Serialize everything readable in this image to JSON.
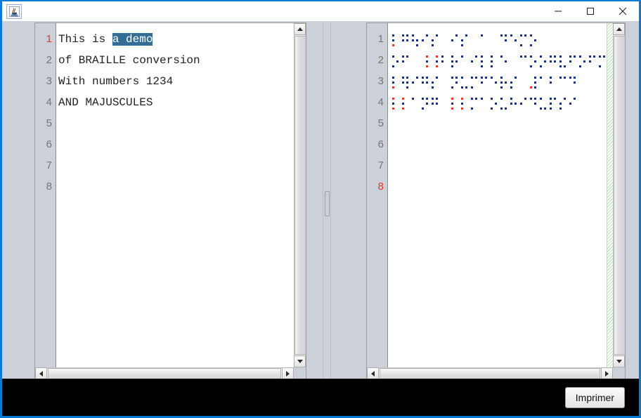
{
  "window": {
    "app_icon": "java-coffee-icon",
    "minimize_label": "—",
    "maximize_label": "□",
    "close_label": "✕"
  },
  "left_editor": {
    "name": "source-text-editor",
    "line_numbers": [
      "1",
      "2",
      "3",
      "4",
      "5",
      "6",
      "7",
      "8"
    ],
    "active_line": 1,
    "lines": [
      {
        "pre": "This is ",
        "selected": "a demo",
        "post": ""
      },
      {
        "pre": "of BRAILLE conversion",
        "selected": "",
        "post": ""
      },
      {
        "pre": "With numbers 1234",
        "selected": "",
        "post": ""
      },
      {
        "pre": "AND MAJUSCULES",
        "selected": "",
        "post": ""
      },
      {
        "pre": "",
        "selected": "",
        "post": ""
      },
      {
        "pre": "",
        "selected": "",
        "post": ""
      },
      {
        "pre": "",
        "selected": "",
        "post": ""
      },
      {
        "pre": "",
        "selected": "",
        "post": ""
      }
    ],
    "selection_text": "a demo"
  },
  "right_editor": {
    "name": "braille-output-editor",
    "line_numbers": [
      "1",
      "2",
      "3",
      "4",
      "5",
      "6",
      "7",
      "8"
    ],
    "active_line": 8,
    "braille_lines": [
      [
        {
          "dots": [
            1,
            2,
            3
          ],
          "red": [
            3
          ]
        },
        {
          "dots": [
            1,
            2,
            4,
            5
          ],
          "red": []
        },
        {
          "dots": [
            1,
            2,
            5,
            6
          ],
          "red": []
        },
        {
          "dots": [
            2,
            4
          ],
          "red": []
        },
        {
          "dots": [
            2,
            3,
            4
          ],
          "red": []
        },
        {
          "dots": [],
          "red": []
        },
        {
          "dots": [
            2,
            4
          ],
          "red": []
        },
        {
          "dots": [
            2,
            3,
            4
          ],
          "red": []
        },
        {
          "dots": [],
          "red": []
        },
        {
          "dots": [
            1
          ],
          "red": []
        },
        {
          "dots": [],
          "red": []
        },
        {
          "dots": [
            1,
            4,
            5
          ],
          "red": []
        },
        {
          "dots": [
            1,
            5
          ],
          "red": []
        },
        {
          "dots": [
            1,
            3,
            4
          ],
          "red": []
        },
        {
          "dots": [
            1,
            3,
            5
          ],
          "red": []
        }
      ],
      [
        {
          "dots": [
            1,
            3,
            5
          ],
          "red": []
        },
        {
          "dots": [
            1,
            2,
            4
          ],
          "red": []
        },
        {
          "dots": [],
          "red": []
        },
        {
          "dots": [
            4,
            5,
            6
          ],
          "red": [
            4,
            6
          ]
        },
        {
          "dots": [
            4,
            5,
            6
          ],
          "red": [
            4,
            6
          ]
        },
        {
          "dots": [
            1,
            2
          ],
          "red": []
        },
        {
          "dots": [
            1,
            2,
            3,
            5
          ],
          "red": []
        },
        {
          "dots": [
            1
          ],
          "red": []
        },
        {
          "dots": [
            2,
            4
          ],
          "red": []
        },
        {
          "dots": [
            1,
            2,
            3
          ],
          "red": []
        },
        {
          "dots": [
            1,
            2,
            3
          ],
          "red": []
        },
        {
          "dots": [
            1,
            5
          ],
          "red": []
        },
        {
          "dots": [],
          "red": []
        },
        {
          "dots": [
            1,
            4
          ],
          "red": []
        },
        {
          "dots": [
            1,
            3,
            5
          ],
          "red": []
        },
        {
          "dots": [
            1,
            3,
            5
          ],
          "red": []
        },
        {
          "dots": [
            1,
            2,
            4,
            5
          ],
          "red": []
        },
        {
          "dots": [
            1,
            2,
            3,
            6
          ],
          "red": []
        },
        {
          "dots": [
            1,
            2,
            4
          ],
          "red": []
        },
        {
          "dots": [
            1,
            3,
            5
          ],
          "red": []
        },
        {
          "dots": [
            1,
            2,
            4
          ],
          "red": []
        },
        {
          "dots": [
            1,
            3,
            4
          ],
          "red": []
        },
        {
          "dots": [
            1,
            3,
            5
          ],
          "red": []
        },
        {
          "dots": [
            1,
            3,
            4,
            5
          ],
          "red": []
        }
      ],
      [
        {
          "dots": [
            1,
            2,
            3
          ],
          "red": [
            3
          ]
        },
        {
          "dots": [
            1,
            2,
            4,
            5,
            6
          ],
          "red": []
        },
        {
          "dots": [
            2,
            4
          ],
          "red": []
        },
        {
          "dots": [
            1,
            2,
            4,
            5
          ],
          "red": []
        },
        {
          "dots": [
            2,
            3,
            4
          ],
          "red": []
        },
        {
          "dots": [],
          "red": []
        },
        {
          "dots": [
            1,
            3,
            4,
            5
          ],
          "red": []
        },
        {
          "dots": [
            1,
            3,
            6
          ],
          "red": []
        },
        {
          "dots": [
            1,
            3,
            4
          ],
          "red": []
        },
        {
          "dots": [
            1,
            2,
            4
          ],
          "red": []
        },
        {
          "dots": [
            1,
            5
          ],
          "red": []
        },
        {
          "dots": [
            1,
            2,
            3,
            5
          ],
          "red": []
        },
        {
          "dots": [
            2,
            3,
            4
          ],
          "red": []
        },
        {
          "dots": [],
          "red": []
        },
        {
          "dots": [
            3,
            4,
            5,
            6
          ],
          "red": [
            3
          ]
        },
        {
          "dots": [
            1
          ],
          "red": []
        },
        {
          "dots": [
            1,
            2
          ],
          "red": []
        },
        {
          "dots": [
            1,
            4
          ],
          "red": []
        },
        {
          "dots": [
            1,
            4,
            5
          ],
          "red": []
        }
      ],
      [
        {
          "dots": [
            1,
            2,
            3
          ],
          "red": [
            1,
            3
          ]
        },
        {
          "dots": [
            1,
            2,
            3
          ],
          "red": [
            1,
            3
          ]
        },
        {
          "dots": [
            1
          ],
          "red": []
        },
        {
          "dots": [
            1,
            3,
            4,
            5
          ],
          "red": []
        },
        {
          "dots": [
            1,
            2,
            4,
            5
          ],
          "red": []
        },
        {
          "dots": [],
          "red": []
        },
        {
          "dots": [
            1,
            2,
            3
          ],
          "red": [
            1,
            3
          ]
        },
        {
          "dots": [
            1,
            2,
            3
          ],
          "red": [
            1,
            3
          ]
        },
        {
          "dots": [
            1,
            3,
            4
          ],
          "red": []
        },
        {
          "dots": [
            1
          ],
          "red": []
        },
        {
          "dots": [
            1,
            3,
            5
          ],
          "red": []
        },
        {
          "dots": [
            1,
            3,
            6
          ],
          "red": []
        },
        {
          "dots": [
            1,
            2,
            5
          ],
          "red": []
        },
        {
          "dots": [
            2,
            4
          ],
          "red": []
        },
        {
          "dots": [
            1,
            4,
            5
          ],
          "red": []
        },
        {
          "dots": [
            1,
            3,
            6
          ],
          "red": []
        },
        {
          "dots": [
            1,
            2,
            3,
            4
          ],
          "red": []
        },
        {
          "dots": [
            2,
            3,
            4
          ],
          "red": []
        },
        {
          "dots": [
            2,
            4
          ],
          "red": []
        }
      ]
    ]
  },
  "bottom_bar": {
    "print_label": "Imprimer"
  },
  "colors": {
    "active_line_number": "#e13b2e",
    "selection_background": "#336c94",
    "braille_dot": "#1b2f7a",
    "braille_marker_dot": "#e8392b",
    "window_border": "#0a7bd4",
    "panel_background": "#ccd1d9",
    "bottom_bar": "#000000",
    "margin_strip": "#bdecbd"
  }
}
